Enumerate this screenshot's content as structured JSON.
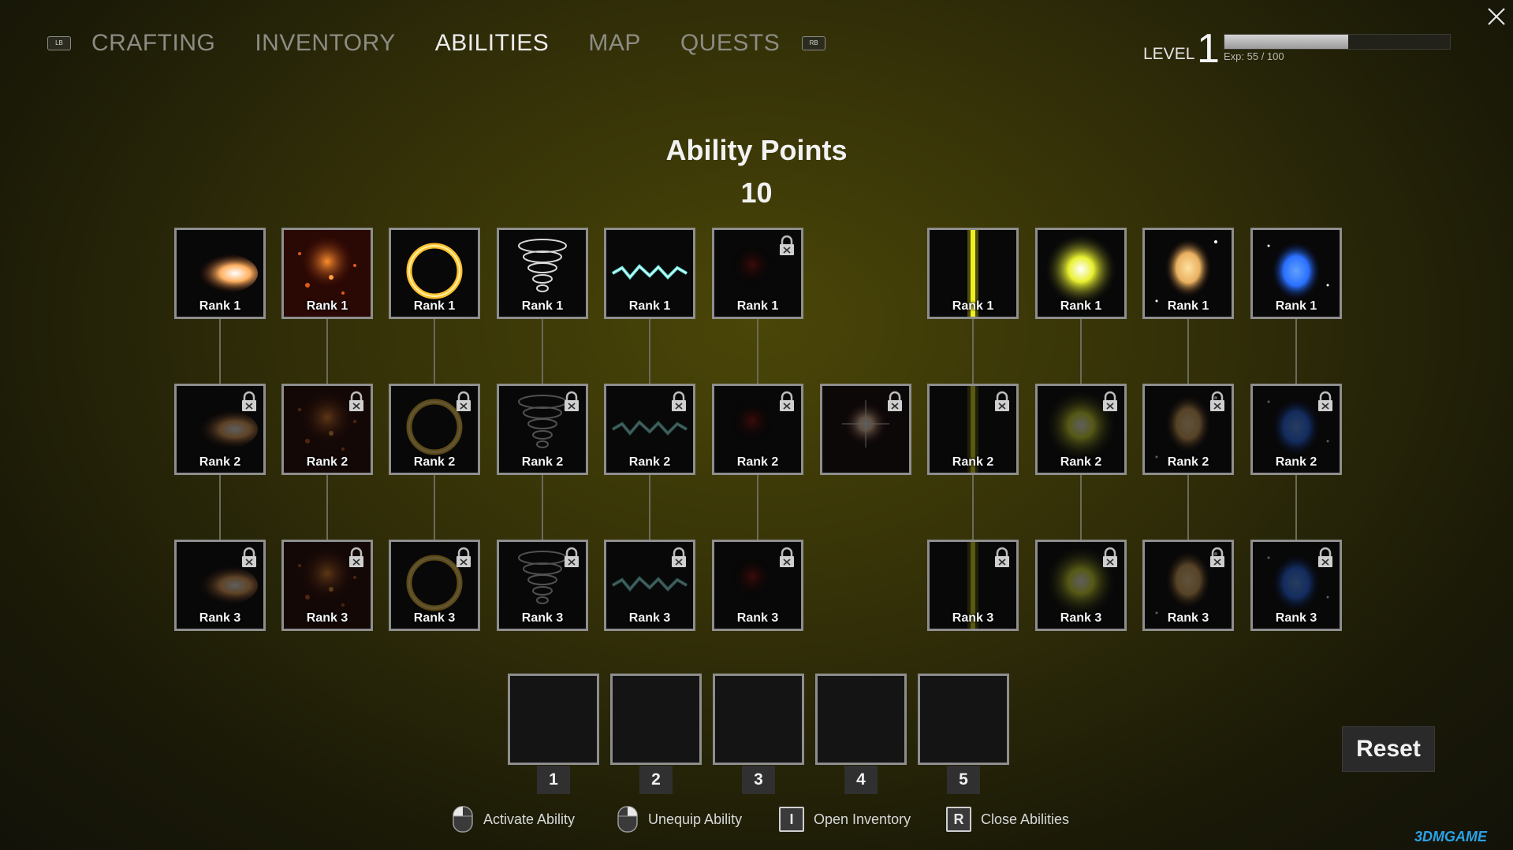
{
  "nav": {
    "left_bumper": "LB",
    "right_bumper": "RB",
    "tabs": [
      {
        "label": "CRAFTING",
        "active": false
      },
      {
        "label": "INVENTORY",
        "active": false
      },
      {
        "label": "ABILITIES",
        "active": true
      },
      {
        "label": "MAP",
        "active": false
      },
      {
        "label": "QUESTS",
        "active": false
      }
    ]
  },
  "level": {
    "label": "LEVEL",
    "value": "1",
    "exp_text": "Exp: 55  /  100",
    "exp_fraction": 0.55
  },
  "header": {
    "title": "Ability Points",
    "points": "10"
  },
  "abilities": [
    {
      "icon": "fireball-icon",
      "color": "#ffb060",
      "ranks": [
        "Rank 1",
        "Rank 2",
        "Rank 3"
      ]
    },
    {
      "icon": "embers-icon",
      "color": "#e05a18",
      "ranks": [
        "Rank 1",
        "Rank 2",
        "Rank 3"
      ]
    },
    {
      "icon": "fire-ring-icon",
      "color": "#ffc030",
      "ranks": [
        "Rank 1",
        "Rank 2",
        "Rank 3"
      ]
    },
    {
      "icon": "tornado-icon",
      "color": "#d8d8d8",
      "ranks": [
        "Rank 1",
        "Rank 2",
        "Rank 3"
      ]
    },
    {
      "icon": "lightning-icon",
      "color": "#60e8e0",
      "ranks": [
        "Rank 1",
        "Rank 2",
        "Rank 3"
      ]
    },
    {
      "icon": "red-glow-icon",
      "color": "#a01010",
      "ranks": [
        "Rank 1",
        "Rank 2",
        "Rank 3"
      ]
    },
    {
      "icon": "starburst-icon",
      "color": "#ffd8b0",
      "ranks": [
        "",
        "",
        ""
      ]
    },
    {
      "icon": "light-beam-icon",
      "color": "#f0f020",
      "ranks": [
        "Rank 1",
        "Rank 2",
        "Rank 3"
      ]
    },
    {
      "icon": "holy-burst-icon",
      "color": "#e8f030",
      "ranks": [
        "Rank 1",
        "Rank 2",
        "Rank 3"
      ]
    },
    {
      "icon": "golden-orb-icon",
      "color": "#e8b060",
      "ranks": [
        "Rank 1",
        "Rank 2",
        "Rank 3"
      ]
    },
    {
      "icon": "blue-orb-icon",
      "color": "#2a70ff",
      "ranks": [
        "Rank 1",
        "Rank 2",
        "Rank 3"
      ]
    }
  ],
  "equip_slots": [
    "1",
    "2",
    "3",
    "4",
    "5"
  ],
  "reset_label": "Reset",
  "hints": [
    {
      "icon": "mouse-left-icon",
      "label": "Activate Ability"
    },
    {
      "icon": "mouse-right-icon",
      "label": "Unequip Ability"
    },
    {
      "key": "I",
      "label": "Open Inventory"
    },
    {
      "key": "R",
      "label": "Close Abilities"
    }
  ],
  "watermark": "3DMGAME"
}
